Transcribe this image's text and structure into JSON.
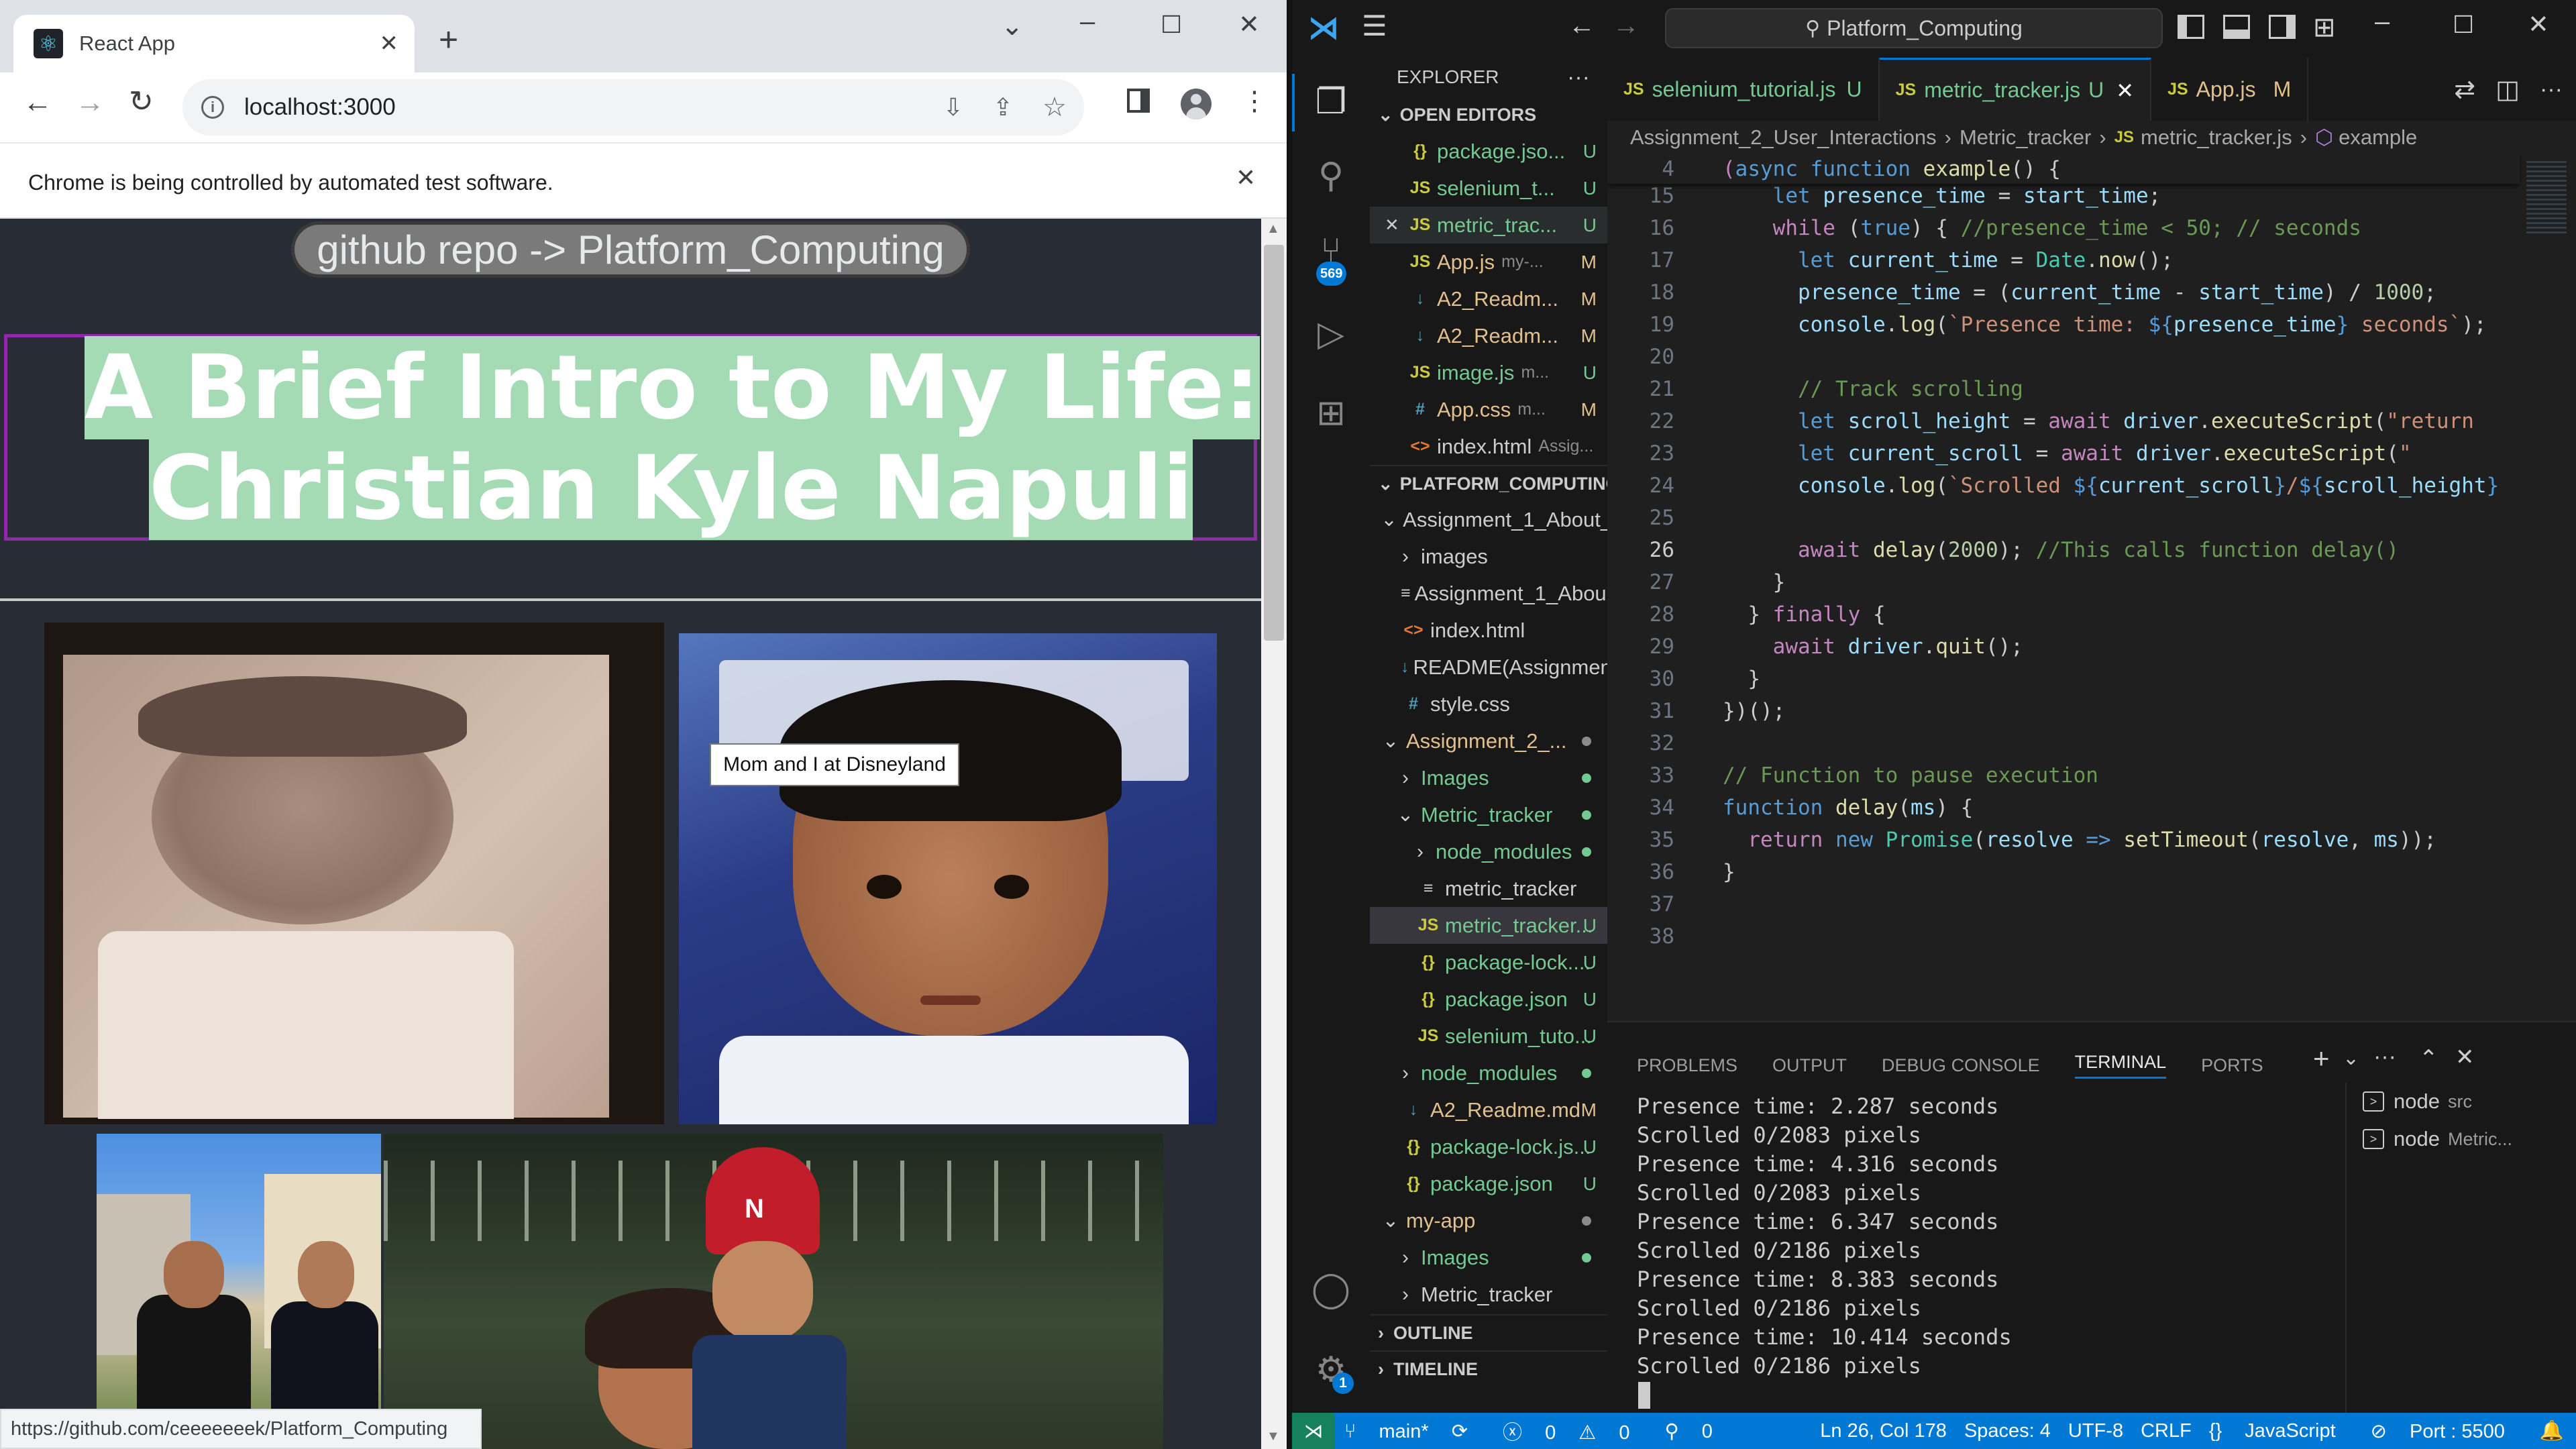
{
  "chrome": {
    "tab_title": "React App",
    "url": "localhost:3000",
    "infobar_text": "Chrome is being controlled by automated test software.",
    "page": {
      "github_link": "github repo -> Platform_Computing",
      "title_line1": "A Brief Intro to My Life:",
      "title_line2": "Christian Kyle Napuli",
      "tooltip": "Mom and I at Disneyland"
    },
    "status_url": "https://github.com/ceeeeeeek/Platform_Computing"
  },
  "vscode": {
    "search_text": "Platform_Computing",
    "source_control_badge": "569",
    "settings_badge": "1",
    "explorer": {
      "header": "EXPLORER",
      "open_editors_label": "OPEN EDITORS",
      "open_editors": [
        {
          "icon": "{}",
          "kind": "json",
          "name": "package.jso...",
          "status": "U"
        },
        {
          "icon": "JS",
          "kind": "js",
          "name": "selenium_t...",
          "status": "U"
        },
        {
          "icon": "JS",
          "kind": "js",
          "name": "metric_trac...",
          "status": "U"
        },
        {
          "icon": "JS",
          "kind": "js",
          "name": "App.js",
          "sub": "my-...",
          "status": "M"
        },
        {
          "icon": "↓",
          "kind": "md",
          "name": "A2_Readm...",
          "status": "M"
        },
        {
          "icon": "↓",
          "kind": "md",
          "name": "A2_Readm...",
          "status": "M"
        },
        {
          "icon": "JS",
          "kind": "js",
          "name": "image.js",
          "sub": "m...",
          "status": "U"
        },
        {
          "icon": "#",
          "kind": "css",
          "name": "App.css",
          "sub": "m...",
          "status": "M"
        },
        {
          "icon": "<>",
          "kind": "html",
          "name": "index.html",
          "sub": "Assig...",
          "status": ""
        }
      ],
      "project_label": "PLATFORM_COMPUTING",
      "tree": [
        {
          "indent": 1,
          "chev": "⌄",
          "name": "Assignment_1_About_...",
          "color": "",
          "status": ""
        },
        {
          "indent": 2,
          "chev": "›",
          "name": "images",
          "color": "",
          "status": ""
        },
        {
          "indent": 2,
          "icon": "≡",
          "kind": "",
          "name": "Assignment_1_Abou...",
          "color": "",
          "status": ""
        },
        {
          "indent": 2,
          "icon": "<>",
          "kind": "html",
          "name": "index.html",
          "color": "",
          "status": ""
        },
        {
          "indent": 2,
          "icon": "↓",
          "kind": "md",
          "name": "README(Assignmen...",
          "color": "",
          "status": ""
        },
        {
          "indent": 2,
          "icon": "#",
          "kind": "css",
          "name": "style.css",
          "color": "",
          "status": ""
        },
        {
          "indent": 1,
          "chev": "⌄",
          "name": "Assignment_2_...",
          "color": "m",
          "status": "dotm"
        },
        {
          "indent": 2,
          "chev": "›",
          "name": "Images",
          "color": "u",
          "status": "dot"
        },
        {
          "indent": 2,
          "chev": "⌄",
          "name": "Metric_tracker",
          "color": "u",
          "status": "dot"
        },
        {
          "indent": 3,
          "chev": "›",
          "name": "node_modules",
          "color": "u",
          "status": "dot"
        },
        {
          "indent": 3,
          "icon": "≡",
          "kind": "",
          "name": "metric_tracker",
          "color": "",
          "status": ""
        },
        {
          "indent": 3,
          "icon": "JS",
          "kind": "js",
          "name": "metric_tracker...",
          "color": "u",
          "status": "U"
        },
        {
          "indent": 3,
          "icon": "{}",
          "kind": "json",
          "name": "package-lock....",
          "color": "u",
          "status": "U"
        },
        {
          "indent": 3,
          "icon": "{}",
          "kind": "json",
          "name": "package.json",
          "color": "u",
          "status": "U"
        },
        {
          "indent": 3,
          "icon": "JS",
          "kind": "js",
          "name": "selenium_tuto...",
          "color": "u",
          "status": "U"
        },
        {
          "indent": 2,
          "chev": "›",
          "name": "node_modules",
          "color": "u",
          "status": "dot"
        },
        {
          "indent": 2,
          "icon": "↓",
          "kind": "md",
          "name": "A2_Readme.md",
          "color": "m",
          "status": "M"
        },
        {
          "indent": 2,
          "icon": "{}",
          "kind": "json",
          "name": "package-lock.js...",
          "color": "u",
          "status": "U"
        },
        {
          "indent": 2,
          "icon": "{}",
          "kind": "json",
          "name": "package.json",
          "color": "u",
          "status": "U"
        },
        {
          "indent": 1,
          "chev": "⌄",
          "name": "my-app",
          "color": "m",
          "status": "dotm"
        },
        {
          "indent": 2,
          "chev": "›",
          "name": "Images",
          "color": "u",
          "status": "dot"
        },
        {
          "indent": 2,
          "chev": "›",
          "name": "Metric_tracker",
          "color": "",
          "status": ""
        }
      ],
      "outline_label": "OUTLINE",
      "timeline_label": "TIMELINE"
    },
    "tabs": [
      {
        "label": "selenium_tutorial.js",
        "status": "U",
        "active": false
      },
      {
        "label": "metric_tracker.js",
        "status": "U",
        "active": true
      },
      {
        "label": "App.js",
        "status": "M",
        "active": false
      }
    ],
    "breadcrumbs": [
      "Assignment_2_User_Interactions",
      "Metric_tracker",
      "metric_tracker.js",
      "example"
    ],
    "sticky_line_number": "4",
    "line_numbers": [
      "15",
      "16",
      "17",
      "18",
      "19",
      "20",
      "21",
      "22",
      "23",
      "24",
      "25",
      "26",
      "27",
      "28",
      "29",
      "30",
      "31",
      "32",
      "33",
      "34",
      "35",
      "36",
      "37",
      "38"
    ],
    "panel_tabs": [
      "PROBLEMS",
      "OUTPUT",
      "DEBUG CONSOLE",
      "TERMINAL",
      "PORTS"
    ],
    "terminal_lines": [
      "Presence time: 2.287 seconds",
      "Scrolled 0/2083 pixels",
      "Presence time: 4.316 seconds",
      "Scrolled 0/2083 pixels",
      "Presence time: 6.347 seconds",
      "Scrolled 0/2186 pixels",
      "Presence time: 8.383 seconds",
      "Scrolled 0/2186 pixels",
      "Presence time: 10.414 seconds",
      "Scrolled 0/2186 pixels"
    ],
    "terminals": [
      {
        "name": "node",
        "sub": "src"
      },
      {
        "name": "node",
        "sub": "Metric..."
      }
    ],
    "statusbar": {
      "branch": "main*",
      "errors": "0",
      "warnings": "0",
      "ports_count": "0",
      "position": "Ln 26, Col 178",
      "spaces": "Spaces: 4",
      "encoding": "UTF-8",
      "eol": "CRLF",
      "language": "JavaScript",
      "port": "Port : 5500"
    }
  }
}
